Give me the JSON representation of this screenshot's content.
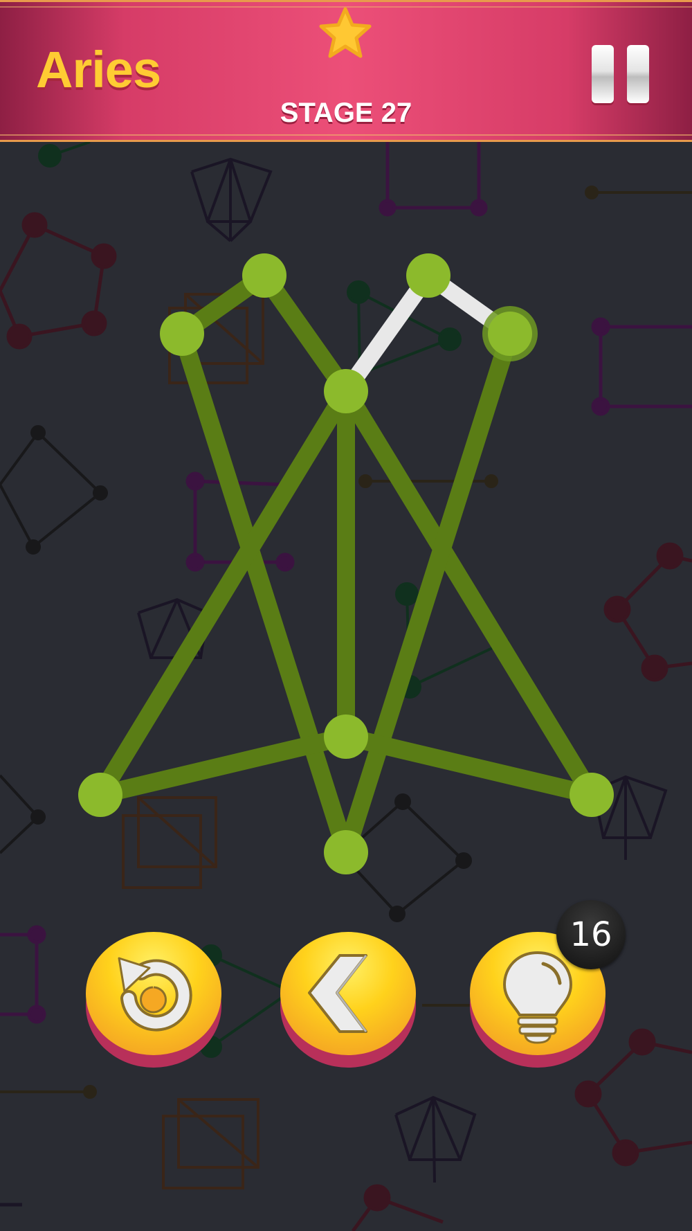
{
  "header": {
    "title": "Aries",
    "stage_label": "STAGE 27",
    "stars_earned": 1,
    "icons": [
      "star-icon",
      "pause-icon"
    ]
  },
  "puzzle": {
    "node_color": "#8cba2c",
    "drawn_edge_color": "#5a7d15",
    "remaining_edge_color": "#e8e8e8",
    "edges_total": 11,
    "edges_drawn": 10,
    "edges_remaining": 1
  },
  "controls": {
    "restart_icon": "restart-icon",
    "undo_icon": "back-arrow-icon",
    "hint_icon": "lightbulb-icon",
    "hint_count": "16"
  },
  "colors": {
    "header_pink": "#ec4f78",
    "title_yellow": "#ffcc33",
    "button_yellow": "#ffd21c",
    "background": "#2a2c33"
  }
}
